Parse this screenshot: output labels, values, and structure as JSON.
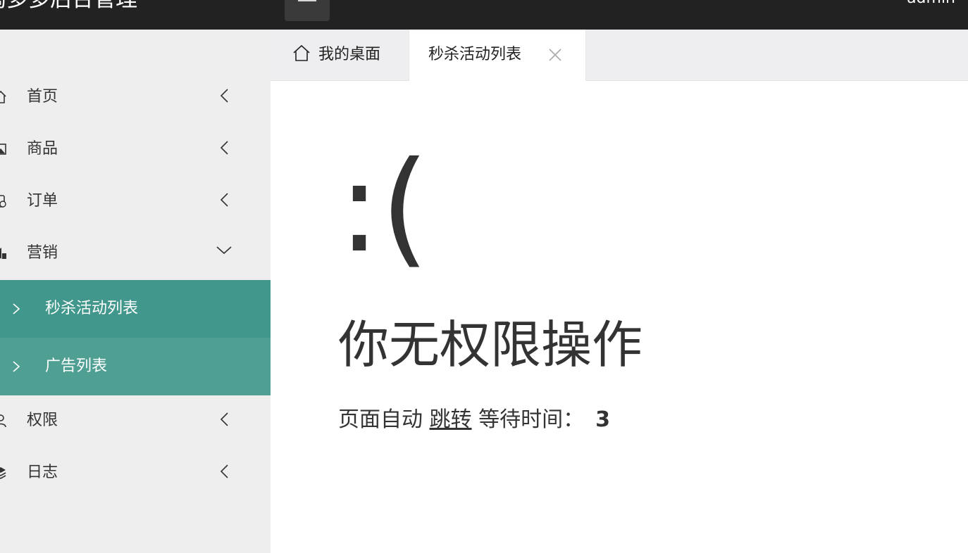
{
  "header": {
    "app_title": "淘多多后台管理",
    "user": "admin",
    "menu_toggle_icon": "menu-icon"
  },
  "sidebar": {
    "items": [
      {
        "label": "首页",
        "icon": "home-icon",
        "expanded": false
      },
      {
        "label": "商品",
        "icon": "image-icon",
        "expanded": false
      },
      {
        "label": "订单",
        "icon": "order-icon",
        "expanded": false
      },
      {
        "label": "营销",
        "icon": "marketing-icon",
        "expanded": true,
        "children": [
          {
            "label": "秒杀活动列表",
            "active": true
          },
          {
            "label": "广告列表",
            "active": false
          }
        ]
      },
      {
        "label": "权限",
        "icon": "user-icon",
        "expanded": false
      },
      {
        "label": "日志",
        "icon": "layers-icon",
        "expanded": false
      }
    ]
  },
  "tabs": [
    {
      "label": "我的桌面",
      "icon": "home-icon",
      "active": false
    },
    {
      "label": "秒杀活动列表",
      "active": true,
      "closable": true
    }
  ],
  "content": {
    "face": ":(",
    "message": "你无权限操作",
    "redirect_prefix": "页面自动",
    "redirect_link": "跳转",
    "wait_label": "等待时间：",
    "countdown": "3"
  },
  "colors": {
    "topbar": "#222222",
    "sidebar_bg": "#eeeeee",
    "submenu_active": "#41978b",
    "submenu": "#4f9f93",
    "text": "#333333"
  }
}
